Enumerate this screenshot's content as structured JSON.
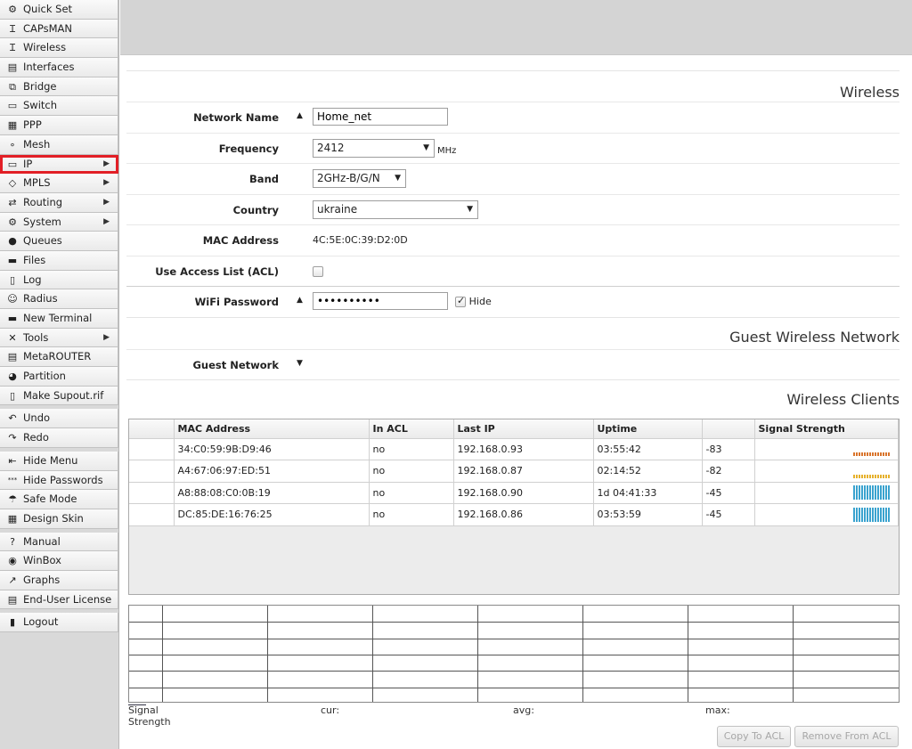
{
  "sidebar": {
    "groups": [
      [
        {
          "label": "Quick Set",
          "icon": "quick-set-icon"
        },
        {
          "label": "CAPsMAN",
          "icon": "antenna-icon"
        },
        {
          "label": "Wireless",
          "icon": "antenna-icon"
        },
        {
          "label": "Interfaces",
          "icon": "interfaces-icon"
        },
        {
          "label": "Bridge",
          "icon": "bridge-icon"
        },
        {
          "label": "Switch",
          "icon": "switch-icon"
        },
        {
          "label": "PPP",
          "icon": "ppp-icon"
        },
        {
          "label": "Mesh",
          "icon": "mesh-icon"
        },
        {
          "label": "IP",
          "icon": "ip-icon",
          "arrow": true,
          "highlight": true
        },
        {
          "label": "MPLS",
          "icon": "mpls-icon",
          "arrow": true
        },
        {
          "label": "Routing",
          "icon": "routing-icon",
          "arrow": true
        },
        {
          "label": "System",
          "icon": "gear-icon",
          "arrow": true
        },
        {
          "label": "Queues",
          "icon": "queues-icon"
        },
        {
          "label": "Files",
          "icon": "folder-icon"
        },
        {
          "label": "Log",
          "icon": "log-icon"
        },
        {
          "label": "Radius",
          "icon": "users-icon"
        },
        {
          "label": "New Terminal",
          "icon": "terminal-icon"
        },
        {
          "label": "Tools",
          "icon": "tools-icon",
          "arrow": true
        },
        {
          "label": "MetaROUTER",
          "icon": "metarouter-icon"
        },
        {
          "label": "Partition",
          "icon": "pie-icon"
        },
        {
          "label": "Make Supout.rif",
          "icon": "file-icon"
        }
      ],
      [
        {
          "label": "Undo",
          "icon": "undo-icon"
        },
        {
          "label": "Redo",
          "icon": "redo-icon"
        }
      ],
      [
        {
          "label": "Hide Menu",
          "icon": "hide-menu-icon"
        },
        {
          "label": "Hide Passwords",
          "icon": "password-icon"
        },
        {
          "label": "Safe Mode",
          "icon": "umbrella-icon"
        },
        {
          "label": "Design Skin",
          "icon": "skin-icon"
        }
      ],
      [
        {
          "label": "Manual",
          "icon": "help-icon"
        },
        {
          "label": "WinBox",
          "icon": "winbox-icon"
        },
        {
          "label": "Graphs",
          "icon": "graph-icon"
        },
        {
          "label": "End-User License",
          "icon": "license-icon"
        }
      ],
      [
        {
          "label": "Logout",
          "icon": "logout-icon"
        }
      ]
    ]
  },
  "wireless": {
    "title": "Wireless",
    "network_name_label": "Network Name",
    "network_name": "Home_net",
    "frequency_label": "Frequency",
    "frequency": "2412",
    "frequency_unit": "MHz",
    "band_label": "Band",
    "band": "2GHz-B/G/N",
    "country_label": "Country",
    "country": "ukraine",
    "mac_label": "MAC Address",
    "mac": "4C:5E:0C:39:D2:0D",
    "acl_label": "Use Access List (ACL)",
    "password_label": "WiFi Password",
    "password": "••••••••••",
    "hide_label": "Hide"
  },
  "guest": {
    "title": "Guest Wireless Network",
    "network_label": "Guest Network"
  },
  "clients": {
    "title": "Wireless Clients",
    "headers": [
      "",
      "MAC Address",
      "In ACL",
      "Last IP",
      "Uptime",
      "",
      "Signal Strength"
    ],
    "rows": [
      {
        "mac": "34:C0:59:9B:D9:46",
        "acl": "no",
        "ip": "192.168.0.93",
        "uptime": "03:55:42",
        "signal": "-83",
        "level": 0.25,
        "color": "#d9742b"
      },
      {
        "mac": "A4:67:06:97:ED:51",
        "acl": "no",
        "ip": "192.168.0.87",
        "uptime": "02:14:52",
        "signal": "-82",
        "level": 0.25,
        "color": "#e6b12d"
      },
      {
        "mac": "A8:88:08:C0:0B:19",
        "acl": "no",
        "ip": "192.168.0.90",
        "uptime": "1d 04:41:33",
        "signal": "-45",
        "level": 1.0,
        "color": "#3aa3cf"
      },
      {
        "mac": "DC:85:DE:16:76:25",
        "acl": "no",
        "ip": "192.168.0.86",
        "uptime": "03:53:59",
        "signal": "-45",
        "level": 1.0,
        "color": "#3aa3cf"
      }
    ]
  },
  "graph": {
    "legend": "Signal Strength",
    "cur_label": "cur:",
    "avg_label": "avg:",
    "max_label": "max:"
  },
  "buttons": {
    "copy": "Copy To ACL",
    "remove": "Remove From ACL"
  }
}
